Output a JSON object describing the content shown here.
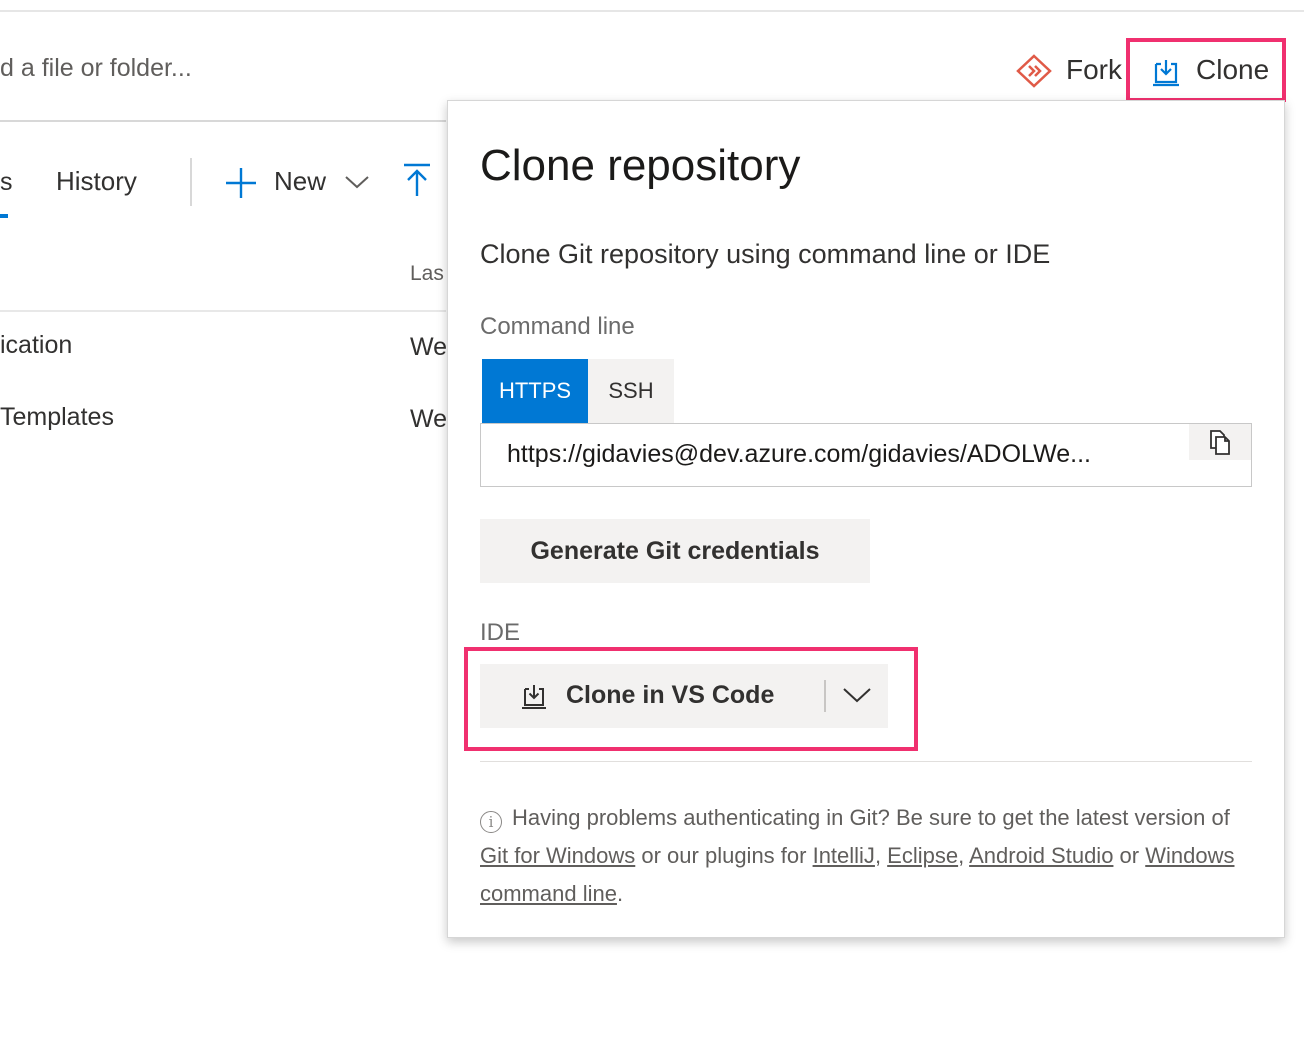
{
  "toolbar": {
    "search_placeholder": "d a file or folder...",
    "fork_label": "Fork",
    "clone_label": "Clone"
  },
  "tabs": {
    "partial_label": "s",
    "history_label": "History",
    "new_label": "New"
  },
  "list": {
    "column_header": "Las",
    "rows": [
      {
        "name": "ication",
        "meta": "We"
      },
      {
        "name": "Templates",
        "meta": "We"
      }
    ]
  },
  "clone_panel": {
    "title": "Clone repository",
    "subtitle": "Clone Git repository using command line or IDE",
    "command_line_label": "Command line",
    "protocols": [
      "HTTPS",
      "SSH"
    ],
    "selected_protocol": "HTTPS",
    "url": "https://gidavies@dev.azure.com/gidavies/ADOLWe...",
    "generate_credentials_label": "Generate Git credentials",
    "ide_label": "IDE",
    "ide_button_label": "Clone in VS Code",
    "help": {
      "part1": "Having problems authenticating in Git? Be sure to get the latest version of ",
      "link_git_windows": "Git for Windows",
      "part2": " or our plugins for ",
      "link_intellij": "IntelliJ",
      "sep1": ", ",
      "link_eclipse": "Eclipse",
      "sep2": ", ",
      "link_android": "Android Studio",
      "part3": " or ",
      "link_windows_cmd": "Windows command line",
      "part4": "."
    }
  },
  "colors": {
    "accent": "#0078d4",
    "highlight": "#f0306f",
    "fork": "#e05a47"
  },
  "icons": {
    "fork": "fork-icon",
    "clone": "clone-download-icon",
    "copy": "copy-icon",
    "info": "info-icon"
  }
}
